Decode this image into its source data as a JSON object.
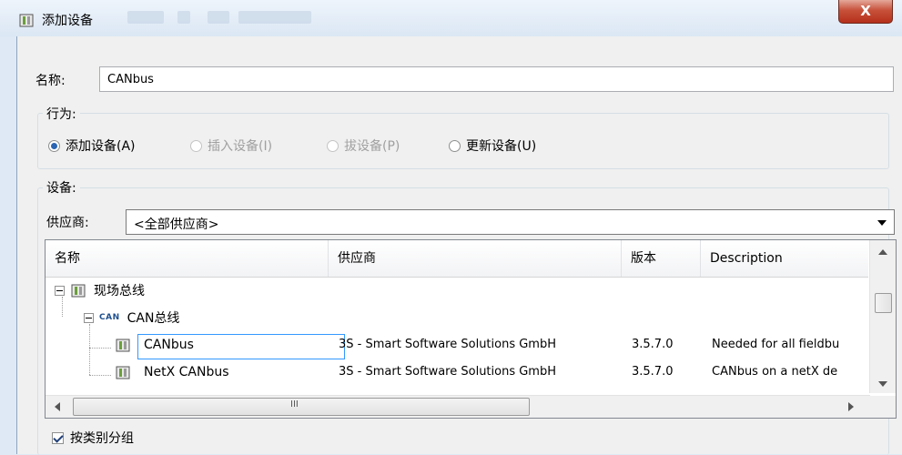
{
  "window": {
    "title": "添加设备",
    "close_label": "X"
  },
  "name_field": {
    "label": "名称:",
    "value": "CANbus"
  },
  "action": {
    "group_label": "行为:",
    "options": [
      {
        "label": "添加设备(A)",
        "checked": true,
        "enabled": true
      },
      {
        "label": "插入设备(I)",
        "checked": false,
        "enabled": false
      },
      {
        "label": "拔设备(P)",
        "checked": false,
        "enabled": false
      },
      {
        "label": "更新设备(U)",
        "checked": false,
        "enabled": true
      }
    ]
  },
  "device": {
    "group_label": "设备:",
    "vendor_label": "供应商:",
    "vendor_value": "<全部供应商>",
    "table": {
      "columns": [
        "名称",
        "供应商",
        "版本",
        "Description"
      ],
      "tree": [
        {
          "label": "现场总线"
        },
        {
          "label": "CAN总线",
          "icon_text": "CAN"
        }
      ],
      "rows": [
        {
          "name": "CANbus",
          "vendor": "3S - Smart Software Solutions GmbH",
          "version": "3.5.7.0",
          "description": "Needed for all fieldbu",
          "selected": true
        },
        {
          "name": "NetX CANbus",
          "vendor": "3S - Smart Software Solutions GmbH",
          "version": "3.5.7.0",
          "description": "CANbus on a netX de",
          "selected": false
        }
      ],
      "scroll_middle_glyph": "III"
    }
  },
  "group_by_category": {
    "label": "按类别分组",
    "checked": true
  },
  "colors": {
    "selection_border": "#3399ff",
    "close_button": "#c7513a",
    "radio_dot": "#2a64b2"
  }
}
